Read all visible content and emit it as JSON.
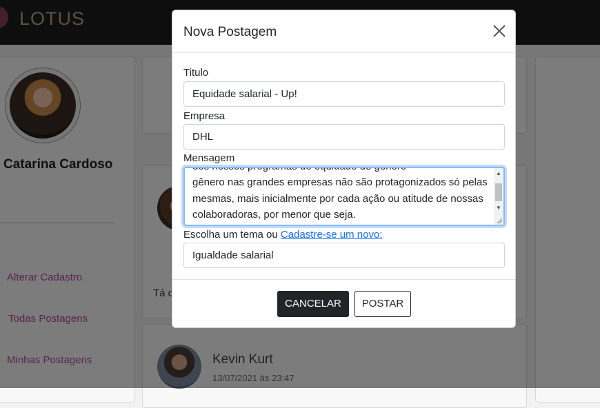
{
  "app": {
    "logo_text": "LOTUS"
  },
  "profile": {
    "name": "Catarina Cardoso"
  },
  "sidebar": {
    "items": [
      {
        "label": "Alterar Cadastro"
      },
      {
        "label": "Todas Postagens"
      },
      {
        "label": "Minhas Postagens"
      }
    ]
  },
  "feed": {
    "partial_text": "Tá c",
    "post": {
      "author": "Kevin Kurt",
      "date": "13/07/2021 às 23:47"
    }
  },
  "modal": {
    "title": "Nova Postagem",
    "titulo_label": "Titulo",
    "titulo_value": "Equidade salarial - Up!",
    "empresa_label": "Empresa",
    "empresa_value": "DHL",
    "mensagem_label": "Mensagem",
    "mensagem_partial_line": "dos nossos programas de equidade de gênero",
    "mensagem_visible": "gênero nas grandes empresas não são protagonizados só pelas mesmas, mais inicialmente por cada ação ou atitude de nossas colaboradoras, por menor que seja.",
    "theme_label": "Escolha um tema ou",
    "theme_link": "Cadastre-se um novo:",
    "theme_value": "Igualdade salarial",
    "cancel_label": "CANCELAR",
    "post_label": "POSTAR"
  },
  "colors": {
    "accent_link": "#b0479a",
    "primary_link": "#0d6efd",
    "topbar": "#1c1c1c",
    "focus_border": "#86b7fe"
  }
}
